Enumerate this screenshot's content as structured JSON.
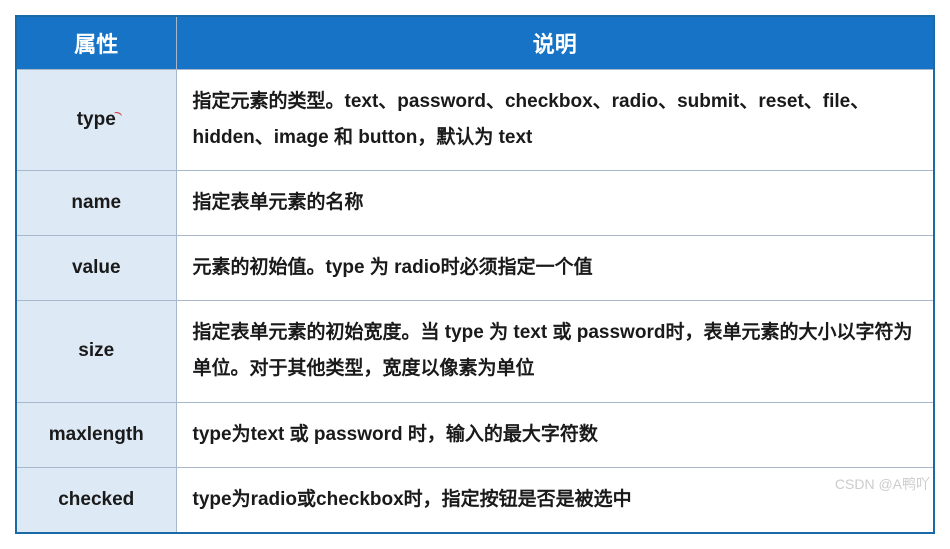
{
  "header": {
    "attr": "属性",
    "desc": "说明"
  },
  "rows": [
    {
      "attr": "type",
      "desc": "指定元素的类型。text、password、checkbox、radio、submit、reset、file、hidden、image 和 button，默认为 text"
    },
    {
      "attr": "name",
      "desc": "指定表单元素的名称"
    },
    {
      "attr": "value",
      "desc": "元素的初始值。type 为 radio时必须指定一个值"
    },
    {
      "attr": "size",
      "desc": "指定表单元素的初始宽度。当 type 为 text 或 password时，表单元素的大小以字符为单位。对于其他类型，宽度以像素为单位"
    },
    {
      "attr": "maxlength",
      "desc": "type为text 或 password 时，输入的最大字符数"
    },
    {
      "attr": "checked",
      "desc": "type为radio或checkbox时，指定按钮是否是被选中"
    }
  ],
  "watermark": "CSDN @A鸭吖"
}
